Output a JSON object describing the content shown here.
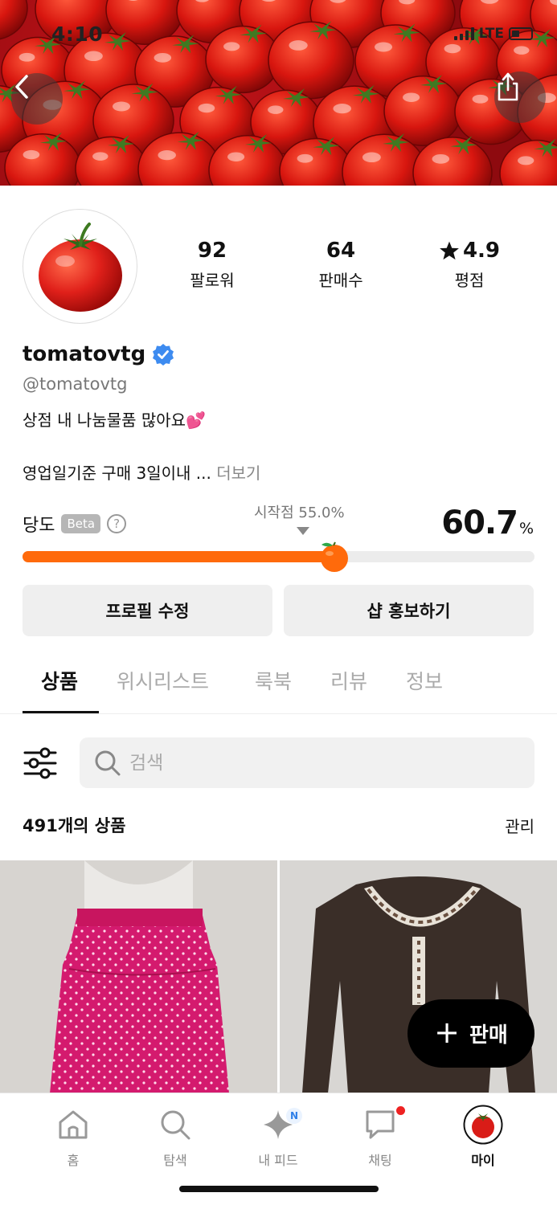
{
  "status_bar": {
    "time": "4:10",
    "network": "LTE"
  },
  "header": {
    "back_icon": "chevron-left-icon",
    "share_icon": "share-icon"
  },
  "profile": {
    "username": "tomatovtg",
    "handle": "@tomatovtg",
    "verified": true,
    "bio_line1": "상점 내 나눔물품 많아요💕",
    "bio_line2": "영업일기준 구매 3일이내 ...",
    "more_label": "더보기",
    "stats": [
      {
        "value": "92",
        "label": "팔로워"
      },
      {
        "value": "64",
        "label": "판매수"
      },
      {
        "value": "4.9",
        "label": "평점"
      }
    ]
  },
  "sweetness": {
    "label": "당도",
    "beta_label": "Beta",
    "help_icon": "question-circle-icon",
    "start_label": "시작점 55.0%",
    "value": "60.7",
    "unit": "%",
    "fill_percent": 60.7,
    "start_percent": 55.0,
    "accent_color": "#ff6a0b"
  },
  "actions": {
    "edit_profile": "프로필 수정",
    "promote_shop": "샵 홍보하기"
  },
  "tabs": [
    {
      "label": "상품",
      "active": true
    },
    {
      "label": "위시리스트",
      "active": false
    },
    {
      "label": "룩북",
      "active": false
    },
    {
      "label": "리뷰",
      "active": false
    },
    {
      "label": "정보",
      "active": false
    }
  ],
  "search": {
    "placeholder": "검색",
    "filter_icon": "sliders-icon"
  },
  "products": {
    "count_number": "491",
    "count_suffix": "개의 상품",
    "manage_label": "관리",
    "items": [
      {
        "description": "pink polka dot skirt"
      },
      {
        "description": "brown long sleeve top"
      }
    ]
  },
  "fab": {
    "plus": "+",
    "label": "판매"
  },
  "bottom_nav": [
    {
      "label": "홈",
      "icon": "home-icon",
      "active": false
    },
    {
      "label": "탐색",
      "icon": "search-icon",
      "active": false
    },
    {
      "label": "내 피드",
      "icon": "sparkle-icon",
      "active": false,
      "badge": "N"
    },
    {
      "label": "채팅",
      "icon": "chat-icon",
      "active": false,
      "dot": true
    },
    {
      "label": "마이",
      "icon": "avatar",
      "active": true
    }
  ]
}
